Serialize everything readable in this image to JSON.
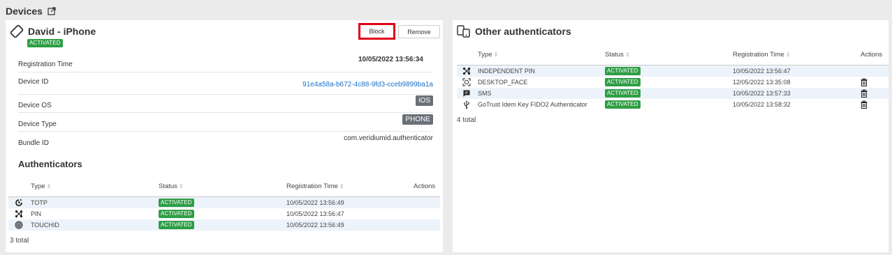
{
  "page": {
    "title": "Devices",
    "external_icon": "external-link-icon"
  },
  "device": {
    "name": "David - iPhone",
    "icon": "rotate-phone-icon",
    "status": "ACTIVATED",
    "block_label": "Block",
    "remove_label": "Remove",
    "registration_time_label": "Registration Time",
    "registration_time": "10/05/2022 13:56:34",
    "device_id_label": "Device ID",
    "device_id": "91e4a58a-b672-4c88-9fd3-cceb9899ba1a",
    "device_os_label": "Device OS",
    "device_os": "iOS",
    "device_type_label": "Device Type",
    "device_type": "PHONE",
    "bundle_id_label": "Bundle ID",
    "bundle_id": "com.veridiumid.authenticator"
  },
  "authenticators": {
    "title": "Authenticators",
    "columns": {
      "type": "Type",
      "status": "Status",
      "registration_time": "Registration Time",
      "actions": "Actions"
    },
    "rows": [
      {
        "icon": "totp-icon",
        "type": "TOTP",
        "status": "ACTIVATED",
        "time": "10/05/2022 13:56:49"
      },
      {
        "icon": "pin-icon",
        "type": "PIN",
        "status": "ACTIVATED",
        "time": "10/05/2022 13:56:47"
      },
      {
        "icon": "fingerprint-icon",
        "type": "TOUCHID",
        "status": "ACTIVATED",
        "time": "10/05/2022 13:56:49"
      }
    ],
    "total": "3 total"
  },
  "other_authenticators": {
    "title": "Other authenticators",
    "icon": "devices-icon",
    "columns": {
      "type": "Type",
      "status": "Status",
      "registration_time": "Registration Time",
      "actions": "Actions"
    },
    "rows": [
      {
        "icon": "pin-icon",
        "type": "INDEPENDENT PIN",
        "status": "ACTIVATED",
        "time": "10/05/2022 13:56:47",
        "deletable": false
      },
      {
        "icon": "face-scan-icon",
        "type": "DESKTOP_FACE",
        "status": "ACTIVATED",
        "time": "12/05/2022 13:35:08",
        "deletable": true
      },
      {
        "icon": "sms-icon",
        "type": "SMS",
        "status": "ACTIVATED",
        "time": "10/05/2022 13:57:33",
        "deletable": true
      },
      {
        "icon": "usb-icon",
        "type": "GoTrust Idem Key FIDO2 Authenticator",
        "status": "ACTIVATED",
        "time": "10/05/2022 13:58:32",
        "deletable": true
      }
    ],
    "total": "4 total"
  },
  "colors": {
    "activated": "#2e9e45",
    "link": "#1a73c8",
    "highlight": "#e2001a",
    "row_alt": "#edf3fb"
  }
}
